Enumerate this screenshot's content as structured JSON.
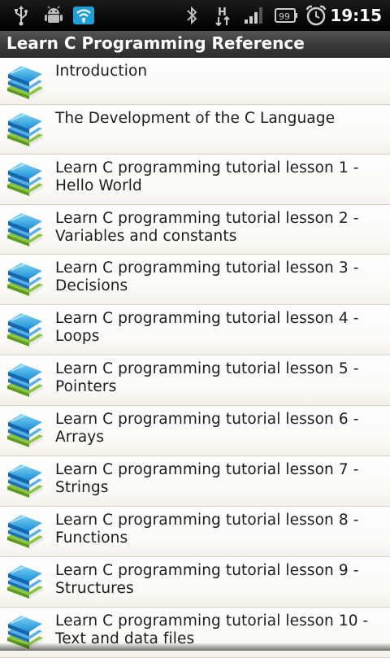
{
  "status_bar": {
    "time": "19:15",
    "battery_level": "99",
    "icons": [
      "usb-icon",
      "android-debug-icon",
      "wifi-icon",
      "bluetooth-icon",
      "hsdpa-icon",
      "signal-icon",
      "battery-icon",
      "alarm-clock-icon"
    ]
  },
  "app": {
    "title": "Learn C Programming Reference"
  },
  "list": {
    "items": [
      {
        "line1": "Introduction",
        "line2": ""
      },
      {
        "line1": "The Development of the C Language",
        "line2": ""
      },
      {
        "line1": "Learn C programming tutorial lesson 1 -",
        "line2": "Hello World"
      },
      {
        "line1": "Learn C programming tutorial lesson 2 -",
        "line2": "Variables and constants"
      },
      {
        "line1": "Learn C programming tutorial lesson 3 -",
        "line2": "Decisions"
      },
      {
        "line1": "Learn C programming tutorial lesson 4 -",
        "line2": "Loops"
      },
      {
        "line1": "Learn C programming tutorial lesson 5 -",
        "line2": "Pointers"
      },
      {
        "line1": "Learn C programming tutorial lesson 6 -",
        "line2": "Arrays"
      },
      {
        "line1": "Learn C programming tutorial lesson 7 -",
        "line2": "Strings"
      },
      {
        "line1": "Learn C programming tutorial lesson 8 -",
        "line2": "Functions"
      },
      {
        "line1": "Learn C programming tutorial lesson 9 -",
        "line2": "Structures"
      },
      {
        "line1": "Learn C programming tutorial lesson 10 -",
        "line2": "Text and data files"
      }
    ]
  }
}
